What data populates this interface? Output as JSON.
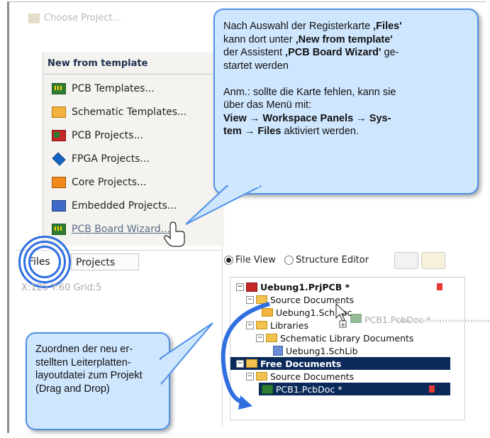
{
  "header_faded": "Choose Project...",
  "template_panel": {
    "title": "New from template",
    "items": [
      {
        "label": "PCB Templates...",
        "icon": "pcb-icon"
      },
      {
        "label": "Schematic Templates...",
        "icon": "schematic-icon"
      },
      {
        "label": "PCB Projects...",
        "icon": "pcb-project-icon"
      },
      {
        "label": "FPGA Projects...",
        "icon": "fpga-icon"
      },
      {
        "label": "Core Projects...",
        "icon": "core-icon"
      },
      {
        "label": "Embedded Projects...",
        "icon": "embedded-icon"
      },
      {
        "label": "PCB Board Wizard...",
        "icon": "pcb-icon"
      }
    ]
  },
  "tabs": {
    "files": "Files",
    "projects": "Projects"
  },
  "status": {
    "text": "X:125 Y:60   Grid:5"
  },
  "workspace": {
    "file_view": "File View",
    "structure_editor": "Structure Editor",
    "tree": {
      "project": "Uebung1.PrjPCB *",
      "source_documents": "Source Documents",
      "sch_doc": "Uebung1.SchDoc",
      "libraries": "Libraries",
      "schematic_library_documents": "Schematic Library Documents",
      "sch_lib": "Uebung1.SchLib",
      "free_documents": "Free Documents",
      "free_source_documents": "Source Documents",
      "pcb_doc": "PCB1.PcbDoc *"
    },
    "drag_ghost": "PCB1.PcbDoc *"
  },
  "callout_top": {
    "l1a": "Nach Auswahl der Registerkarte ",
    "l1b": "‚Files'",
    "l2a": "kann dort unter ",
    "l2b": "‚New from template'",
    "l3a": "der Assistent ",
    "l3b": "‚PCB Board Wizard'",
    "l3c": " ge-",
    "l4": "startet werden",
    "l5": "Anm.: sollte die Karte fehlen, kann sie",
    "l6": "über das Menü mit:",
    "l7": "View → Workspace Panels → Sys-",
    "l8a": "tem → Files",
    "l8b": " aktiviert werden."
  },
  "callout_bottom": {
    "l1": "Zuordnen der neu er-",
    "l2": "stellten Leiterplatten-",
    "l3": "layoutdatei zum Projekt",
    "l4": "(Drag and Drop)"
  },
  "colors": {
    "accent": "#2f6fe0",
    "callout_bg": "#cfe6ff",
    "selection": "#0a2a5a"
  }
}
